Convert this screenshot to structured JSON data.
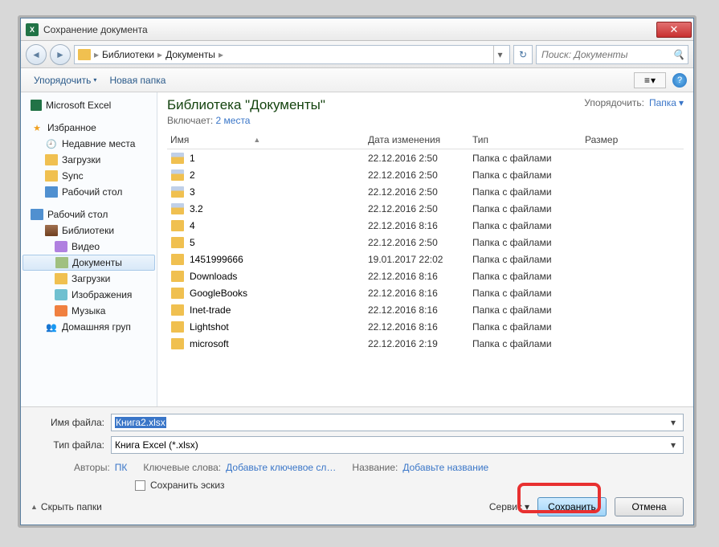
{
  "window": {
    "title": "Сохранение документа",
    "close": "✕"
  },
  "nav": {
    "back": "◄",
    "forward": "►",
    "refresh": "↻",
    "crumbs": [
      "Библиотеки",
      "Документы"
    ],
    "sep": "▸",
    "search_placeholder": "Поиск: Документы",
    "drop": "▾"
  },
  "toolbar": {
    "organize": "Упорядочить",
    "new_folder": "Новая папка",
    "drop": "▾",
    "view_lines": "≡",
    "help": "?"
  },
  "sidebar": {
    "excel": "Microsoft Excel",
    "favorites": "Избранное",
    "fav_items": [
      "Недавние места",
      "Загрузки",
      "Sync",
      "Рабочий стол"
    ],
    "desktop": "Рабочий стол",
    "libraries": "Библиотеки",
    "lib_items": [
      "Видео",
      "Документы",
      "Загрузки",
      "Изображения",
      "Музыка"
    ],
    "homegroup": "Домашняя груп"
  },
  "library": {
    "title": "Библиотека \"Документы\"",
    "includes_label": "Включает:",
    "includes_link": "2 места",
    "arrange_label": "Упорядочить:",
    "arrange_value": "Папка",
    "drop": "▾"
  },
  "columns": {
    "name": "Имя",
    "date": "Дата изменения",
    "type": "Тип",
    "size": "Размер",
    "arrow": "▲"
  },
  "folder_type": "Папка с файлами",
  "files": [
    {
      "name": "1",
      "date": "22.12.2016 2:50",
      "icon": "stash"
    },
    {
      "name": "2",
      "date": "22.12.2016 2:50",
      "icon": "stash"
    },
    {
      "name": "3",
      "date": "22.12.2016 2:50",
      "icon": "stash"
    },
    {
      "name": "3.2",
      "date": "22.12.2016 2:50",
      "icon": "stash"
    },
    {
      "name": "4",
      "date": "22.12.2016 8:16",
      "icon": "folder"
    },
    {
      "name": "5",
      "date": "22.12.2016 2:50",
      "icon": "folder"
    },
    {
      "name": "1451999666",
      "date": "19.01.2017 22:02",
      "icon": "folder"
    },
    {
      "name": "Downloads",
      "date": "22.12.2016 8:16",
      "icon": "folder"
    },
    {
      "name": "GoogleBooks",
      "date": "22.12.2016 8:16",
      "icon": "folder"
    },
    {
      "name": "Inet-trade",
      "date": "22.12.2016 8:16",
      "icon": "folder"
    },
    {
      "name": "Lightshot",
      "date": "22.12.2016 8:16",
      "icon": "folder"
    },
    {
      "name": "microsoft",
      "date": "22.12.2016 2:19",
      "icon": "folder"
    }
  ],
  "fields": {
    "filename_label": "Имя файла:",
    "filename_value": "Книга2.xlsx",
    "filetype_label": "Тип файла:",
    "filetype_value": "Книга Excel (*.xlsx)",
    "drop": "▾"
  },
  "meta": {
    "authors_label": "Авторы:",
    "authors_value": "ПК",
    "keywords_label": "Ключевые слова:",
    "keywords_value": "Добавьте ключевое сл…",
    "title_label": "Название:",
    "title_value": "Добавьте название"
  },
  "thumb": "Сохранить эскиз",
  "actions": {
    "hide": "Скрыть папки",
    "chev": "▲",
    "tools": "Сервис",
    "drop": "▾",
    "save": "Сохранить",
    "cancel": "Отмена"
  }
}
